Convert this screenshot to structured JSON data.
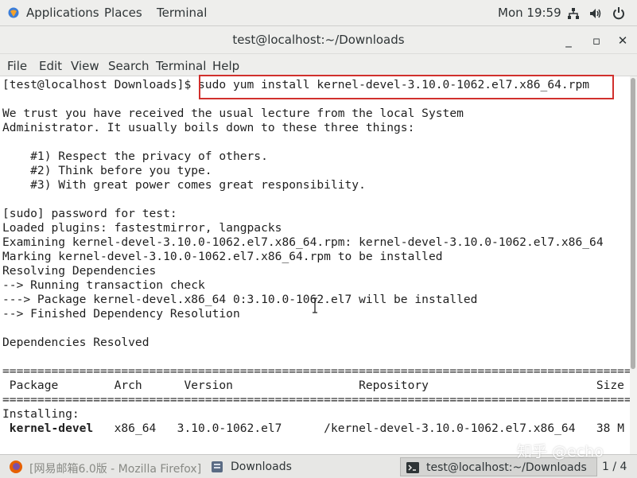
{
  "topbar": {
    "applications_label": "Applications",
    "places_label": "Places",
    "terminal_label": "Terminal",
    "clock": "Mon 19:59"
  },
  "window": {
    "title": "test@localhost:~/Downloads",
    "minimize_glyph": "_",
    "maximize_glyph": "▫",
    "close_glyph": "✕"
  },
  "menubar": {
    "file": "File",
    "edit": "Edit",
    "view": "View",
    "search": "Search",
    "terminal": "Terminal",
    "help": "Help"
  },
  "terminal": {
    "prompt": "[test@localhost Downloads]$ ",
    "command": "sudo yum install kernel-devel-3.10.0-1062.el7.x86_64.rpm",
    "lines": [
      "We trust you have received the usual lecture from the local System",
      "Administrator. It usually boils down to these three things:",
      "    #1) Respect the privacy of others.",
      "    #2) Think before you type.",
      "    #3) With great power comes great responsibility.",
      "[sudo] password for test:",
      "Loaded plugins: fastestmirror, langpacks",
      "Examining kernel-devel-3.10.0-1062.el7.x86_64.rpm: kernel-devel-3.10.0-1062.el7.x86_64",
      "Marking kernel-devel-3.10.0-1062.el7.x86_64.rpm to be installed",
      "Resolving Dependencies",
      "--> Running transaction check",
      "---> Package kernel-devel.x86_64 0:3.10.0-1062.el7 will be installed",
      "--> Finished Dependency Resolution",
      "Dependencies Resolved",
      "==========================================================================================",
      " Package        Arch      Version                  Repository                        Size",
      "==========================================================================================",
      "Installing:"
    ],
    "row": {
      "package": "kernel-devel",
      "rest": "   x86_64   3.10.0-1062.el7      /kernel-devel-3.10.0-1062.el7.x86_64   38 M"
    }
  },
  "taskbar": {
    "firefox": "[网易邮箱6.0版 - Mozilla Firefox]",
    "downloads": "Downloads",
    "terminal": "test@localhost:~/Downloads",
    "workspace": "1 / 4"
  },
  "watermark": "知乎 @echo"
}
